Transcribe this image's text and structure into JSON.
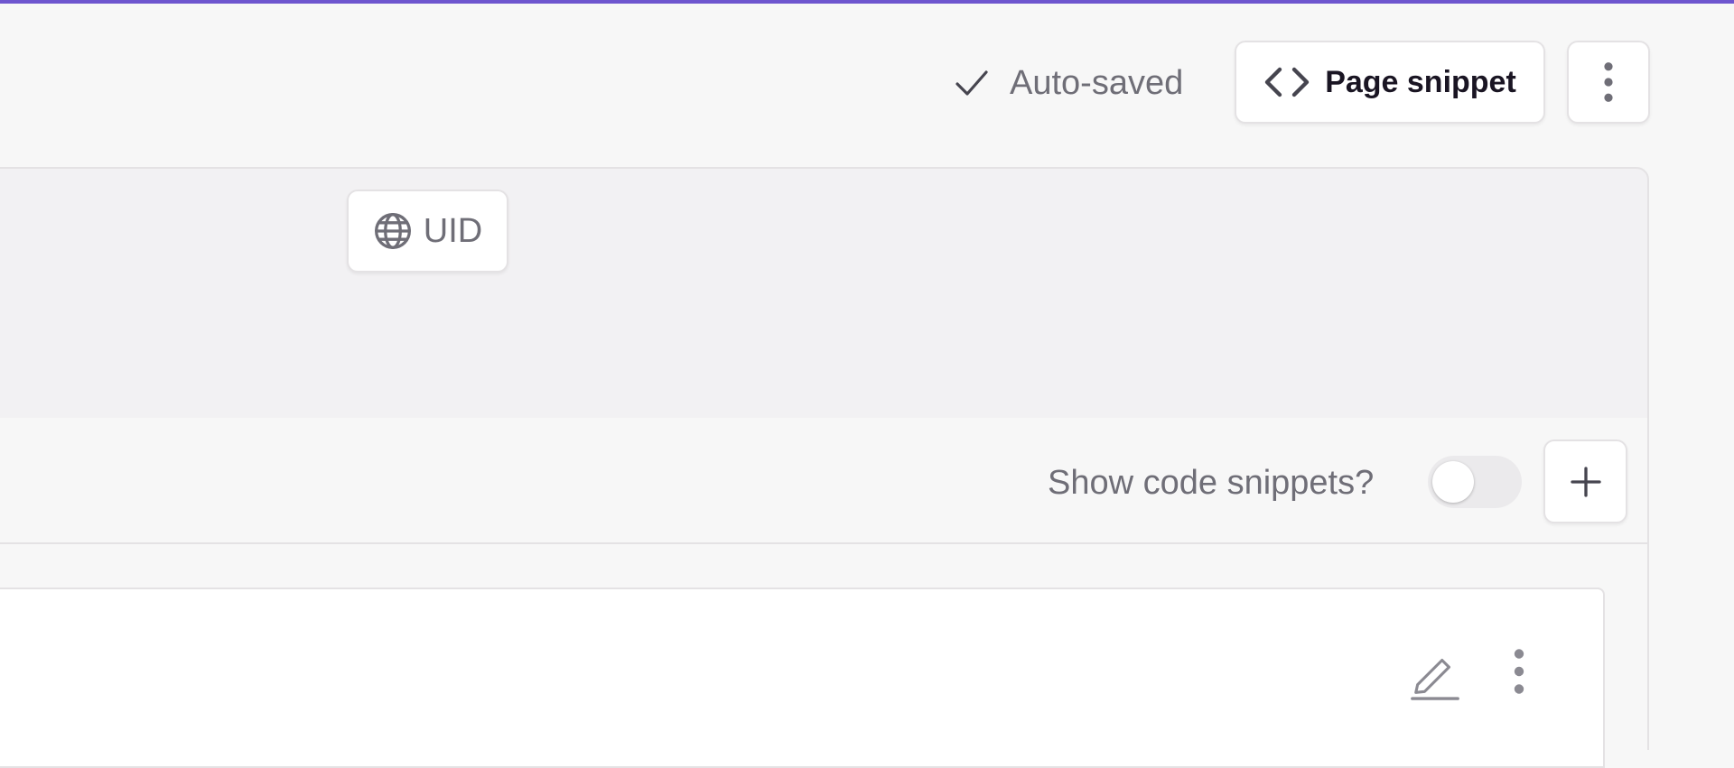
{
  "header": {
    "autosave_label": "Auto-saved",
    "autosave_icon": "check-icon",
    "snippet_button_label": "Page snippet",
    "snippet_icon": "code-icon",
    "more_icon": "more-vertical-icon"
  },
  "fields": {
    "uid_label": "UID",
    "uid_icon": "globe-icon"
  },
  "slices": {
    "show_snippets_label": "Show code snippets?",
    "show_snippets_enabled": false,
    "add_icon": "plus-icon"
  },
  "slice_card": {
    "edit_icon": "pencil-icon",
    "more_icon": "more-vertical-icon"
  },
  "colors": {
    "accent": "#6e56cf",
    "text_primary": "#1a1523",
    "text_muted": "#6f6e77",
    "border": "#e4e2e4"
  }
}
